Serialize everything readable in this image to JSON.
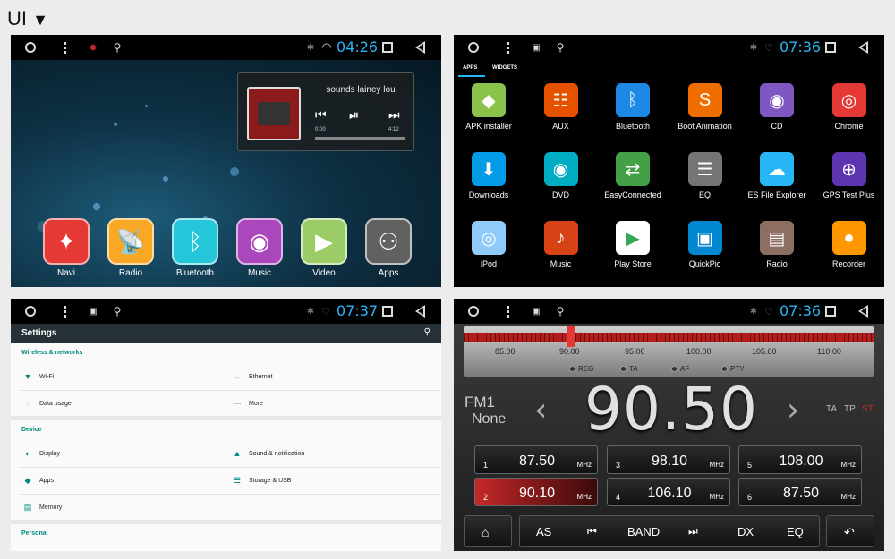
{
  "header": {
    "title": "UI",
    "dropdown_icon": "triangle-down-icon"
  },
  "colors": {
    "accent": "#29b6f6",
    "settings_section": "#00897b",
    "radio_red": "#c62828"
  },
  "screen1": {
    "time": "04:26",
    "music_widget": {
      "title": "sounds lainey lou",
      "time_start": "0:00",
      "time_end": "4:12"
    },
    "dock": [
      {
        "label": "Navi",
        "icon": "compass-icon",
        "color": "#e53935"
      },
      {
        "label": "Radio",
        "icon": "radio-tower-icon",
        "color": "#f9a825"
      },
      {
        "label": "Bluetooth",
        "icon": "bluetooth-icon",
        "color": "#26c6da"
      },
      {
        "label": "Music",
        "icon": "music-disc-icon",
        "color": "#ab47bc"
      },
      {
        "label": "Video",
        "icon": "play-icon",
        "color": "#9ccc65"
      },
      {
        "label": "Apps",
        "icon": "apps-grid-icon",
        "color": "#616161"
      }
    ]
  },
  "screen2": {
    "time": "07:36",
    "tabs": [
      "APPS",
      "WIDGETS"
    ],
    "apps": [
      {
        "label": "APK installer",
        "icon": "android-icon",
        "color": "#8bc34a"
      },
      {
        "label": "AUX",
        "icon": "mixer-icon",
        "color": "#e65100"
      },
      {
        "label": "Bluetooth",
        "icon": "bluetooth-icon",
        "color": "#1e88e5"
      },
      {
        "label": "Boot Animation",
        "icon": "s-logo-icon",
        "color": "#ef6c00"
      },
      {
        "label": "CD",
        "icon": "disc-icon",
        "color": "#7e57c2"
      },
      {
        "label": "Chrome",
        "icon": "chrome-icon",
        "color": "#e53935"
      },
      {
        "label": "Downloads",
        "icon": "download-icon",
        "color": "#039be5"
      },
      {
        "label": "DVD",
        "icon": "dvd-icon",
        "color": "#00acc1"
      },
      {
        "label": "EasyConnected",
        "icon": "easyconnect-icon",
        "color": "#43a047"
      },
      {
        "label": "EQ",
        "icon": "equalizer-icon",
        "color": "#757575"
      },
      {
        "label": "ES File Explorer",
        "icon": "folder-cloud-icon",
        "color": "#29b6f6"
      },
      {
        "label": "GPS Test Plus",
        "icon": "globe-icon",
        "color": "#5e35b1"
      },
      {
        "label": "iPod",
        "icon": "ipod-icon",
        "color": "#90caf9"
      },
      {
        "label": "Music",
        "icon": "microphone-icon",
        "color": "#d84315"
      },
      {
        "label": "Play Store",
        "icon": "play-store-icon",
        "color": "#ffffff"
      },
      {
        "label": "QuickPic",
        "icon": "quickpic-icon",
        "color": "#0288d1"
      },
      {
        "label": "Radio",
        "icon": "radio-icon",
        "color": "#8d6e63"
      },
      {
        "label": "Recorder",
        "icon": "camera-icon",
        "color": "#ff9800"
      }
    ]
  },
  "screen3": {
    "time": "07:37",
    "title": "Settings",
    "sections": {
      "wireless": "Wireless & networks",
      "device": "Device",
      "personal": "Personal"
    },
    "items": {
      "wifi": "Wi-Fi",
      "ethernet": "Ethernet",
      "data_usage": "Data usage",
      "more": "More",
      "display": "Display",
      "sound": "Sound & notification",
      "apps": "Apps",
      "storage": "Storage & USB",
      "memory": "Memory"
    }
  },
  "screen4": {
    "time": "07:36",
    "scale_labels": [
      "85.00",
      "90.00",
      "95.00",
      "100.00",
      "105.00",
      "110.00"
    ],
    "flags": [
      "REG",
      "TA",
      "AF",
      "PTY"
    ],
    "band": "FM1",
    "station": "None",
    "frequency_int": "90",
    "frequency_dot": ".",
    "frequency_dec": "50",
    "tuned_frequency": 90.0,
    "indicators": [
      "TA",
      "TP",
      "ST"
    ],
    "presets": [
      {
        "num": "1",
        "freq": "87.50",
        "unit": "MHz",
        "active": false
      },
      {
        "num": "3",
        "freq": "98.10",
        "unit": "MHz",
        "active": false
      },
      {
        "num": "5",
        "freq": "108.00",
        "unit": "MHz",
        "active": false
      },
      {
        "num": "2",
        "freq": "90.10",
        "unit": "MHz",
        "active": true
      },
      {
        "num": "4",
        "freq": "106.10",
        "unit": "MHz",
        "active": false
      },
      {
        "num": "6",
        "freq": "87.50",
        "unit": "MHz",
        "active": false
      }
    ],
    "controls": {
      "as": "AS",
      "band": "BAND",
      "dx": "DX",
      "eq": "EQ"
    }
  }
}
